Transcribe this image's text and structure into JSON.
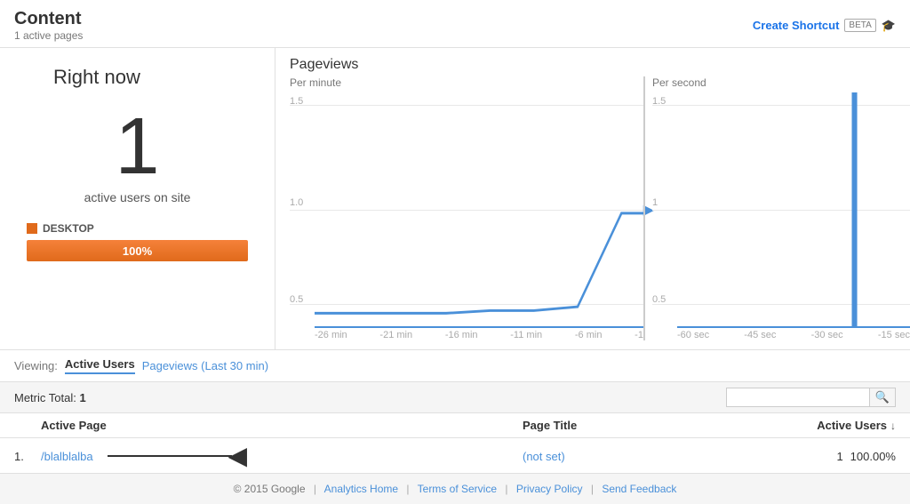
{
  "header": {
    "title": "Content",
    "subtitle": "1 active pages",
    "create_shortcut_label": "Create Shortcut",
    "beta_label": "BETA"
  },
  "left_panel": {
    "right_now_label": "Right now",
    "big_number": "1",
    "active_users_label": "active users on site",
    "desktop_label": "DESKTOP",
    "progress_percentage": "100%",
    "progress_width": "100%"
  },
  "pageviews": {
    "title": "Pageviews",
    "per_minute_label": "Per minute",
    "per_second_label": "Per second",
    "y_labels_minute": [
      "1.5",
      "1.0",
      "0.5"
    ],
    "y_labels_second": [
      "1.5",
      "1",
      "0.5"
    ],
    "x_labels_minute": [
      "-26 min",
      "-21 min",
      "-16 min",
      "-11 min",
      "-6 min",
      "-1"
    ],
    "x_labels_second": [
      "-60 sec",
      "-45 sec",
      "-30 sec",
      "-15 sec"
    ]
  },
  "viewing_bar": {
    "label": "Viewing:",
    "active_tab": "Active Users",
    "inactive_tab": "Pageviews (Last 30 min)"
  },
  "metric_bar": {
    "label": "Metric Total:",
    "value": "1",
    "search_placeholder": ""
  },
  "table": {
    "col_page": "Active Page",
    "col_title": "Page Title",
    "col_users": "Active Users",
    "rows": [
      {
        "num": "1.",
        "page": "/blalblalba",
        "title": "(not set)",
        "users": "1",
        "percentage": "100.00%"
      }
    ]
  },
  "footer": {
    "copyright": "© 2015 Google",
    "links": [
      "Analytics Home",
      "Terms of Service",
      "Privacy Policy",
      "Send Feedback"
    ]
  }
}
